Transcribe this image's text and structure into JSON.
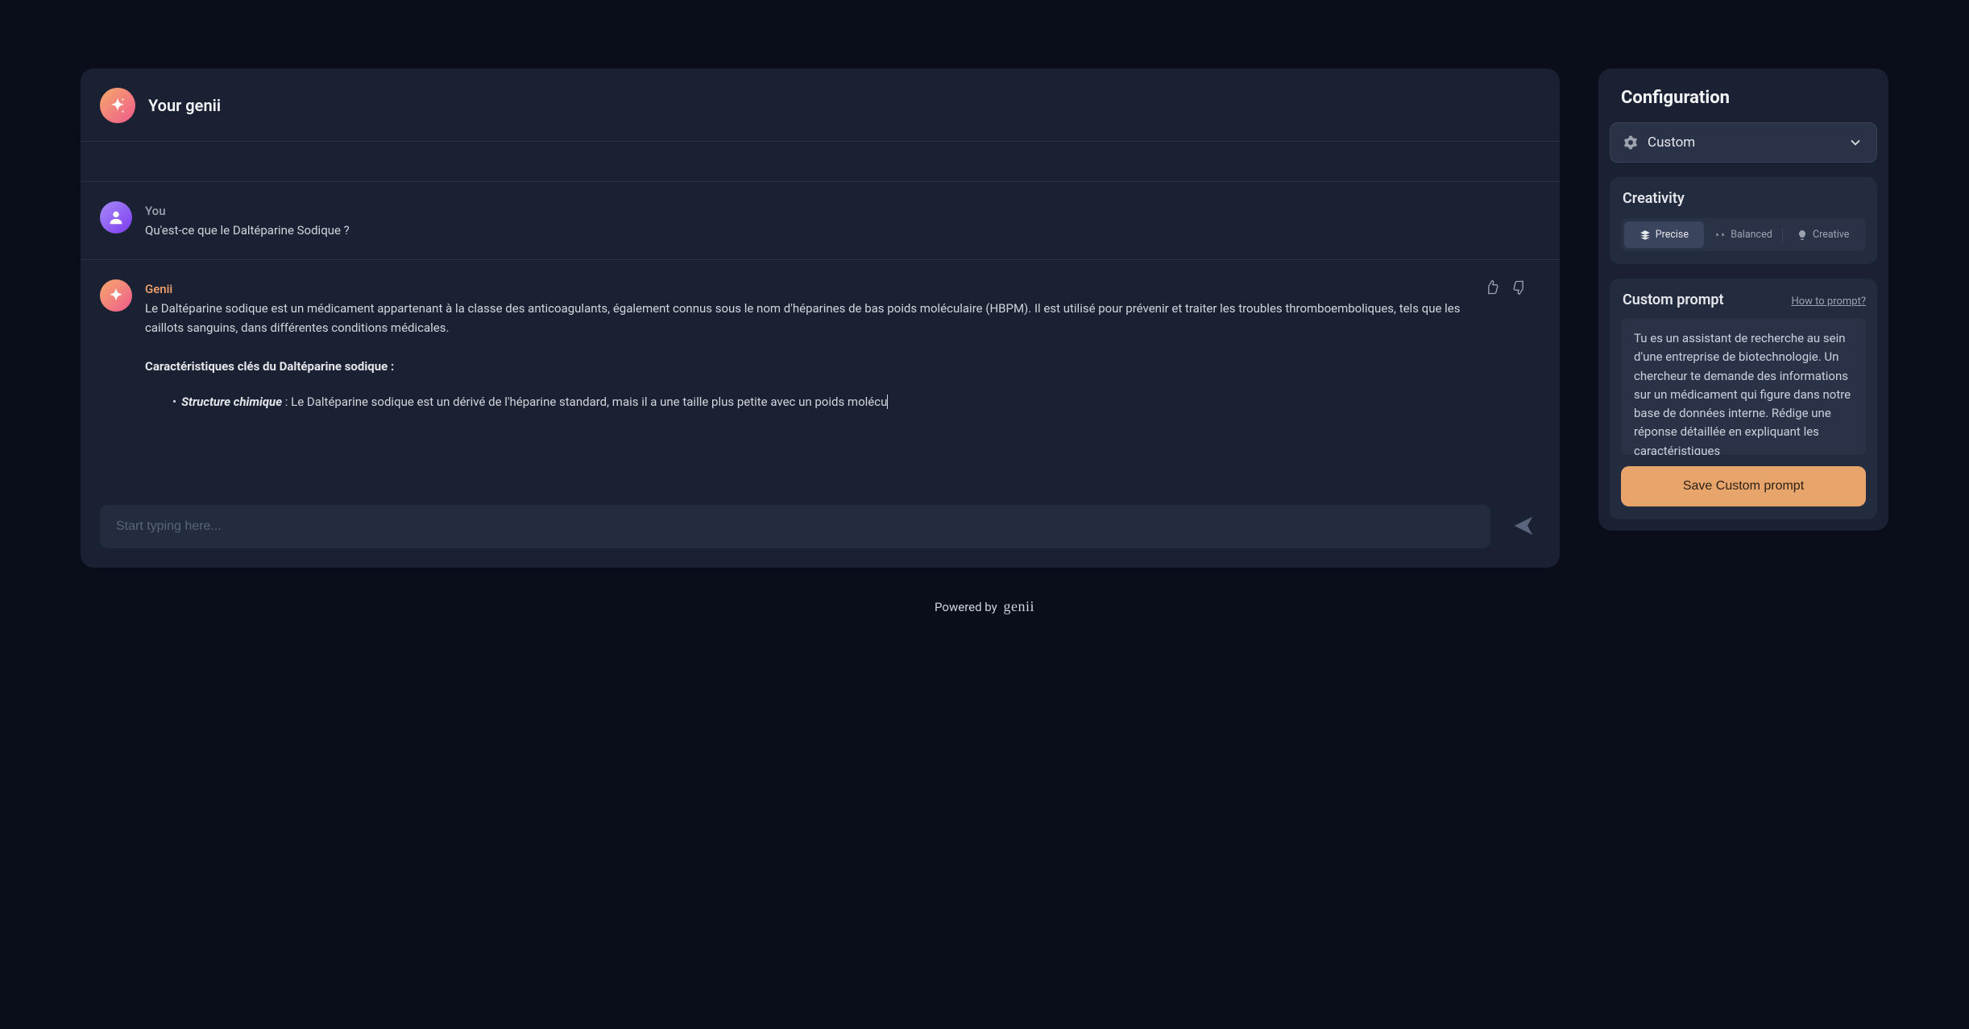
{
  "chat": {
    "header_title": "Your genii",
    "user_label": "You",
    "user_message": "Qu'est-ce que le Daltéparine Sodique ?",
    "assistant_label": "Genii",
    "assistant_intro": "Le Daltéparine sodique est un médicament appartenant à la classe des anticoagulants, également connus sous le nom d'héparines de bas poids moléculaire (HBPM). Il est utilisé pour prévenir et traiter les troubles thromboemboliques, tels que les caillots sanguins, dans différentes conditions médicales.",
    "assistant_section_title": "Caractéristiques clés du Daltéparine sodique :",
    "assistant_bullet_label": "Structure chimique",
    "assistant_bullet_text": " : Le Daltéparine sodique est un dérivé de l'héparine standard, mais il a une taille plus petite avec un poids molécu",
    "composer_placeholder": "Start typing here..."
  },
  "config": {
    "title": "Configuration",
    "preset_label": "Custom",
    "creativity": {
      "title": "Creativity",
      "options": [
        "Precise",
        "Balanced",
        "Creative"
      ],
      "active": "Precise"
    },
    "custom_prompt": {
      "title": "Custom prompt",
      "help_link": "How to prompt?",
      "text": "Tu es un assistant de recherche au sein d'une entreprise de biotechnologie. Un chercheur te demande des informations sur un médicament qui figure dans notre base de données interne. Rédige une réponse détaillée en expliquant les caractéristiques",
      "save_label": "Save Custom prompt"
    }
  },
  "footer": {
    "powered_by": "Powered by",
    "brand": "genii"
  }
}
